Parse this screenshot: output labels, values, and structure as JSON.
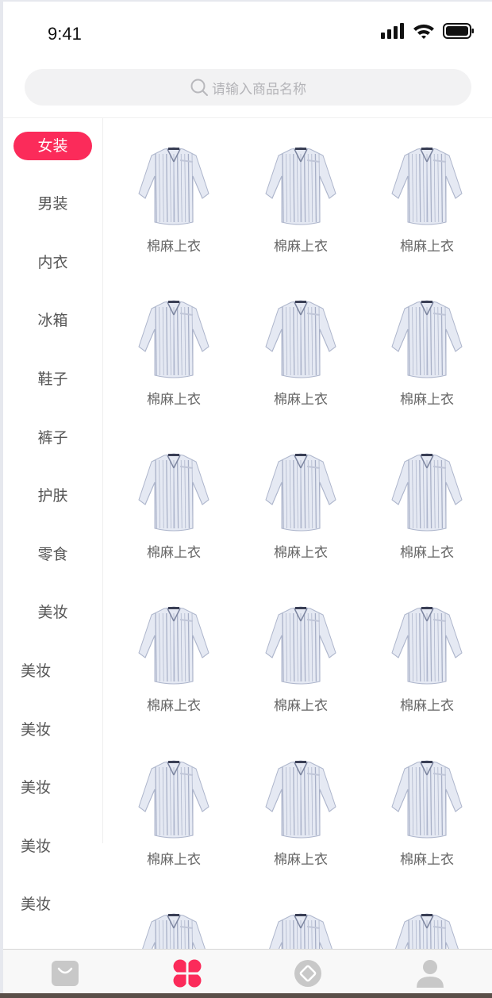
{
  "status": {
    "time": "9:41",
    "icons": [
      "signal-bars-icon",
      "wifi-icon",
      "battery-icon"
    ]
  },
  "search": {
    "placeholder": "请输入商品名称",
    "icon": "search-icon"
  },
  "categories": [
    {
      "label": "女装",
      "active": true
    },
    {
      "label": "男装"
    },
    {
      "label": "内衣"
    },
    {
      "label": "冰箱"
    },
    {
      "label": "鞋子"
    },
    {
      "label": "裤子"
    },
    {
      "label": "护肤"
    },
    {
      "label": "零食"
    },
    {
      "label": "美妆"
    },
    {
      "label": "美妆"
    },
    {
      "label": "美妆"
    },
    {
      "label": "美妆"
    },
    {
      "label": "美妆"
    },
    {
      "label": "美妆"
    }
  ],
  "products": [
    {
      "name": "棉麻上衣"
    },
    {
      "name": "棉麻上衣"
    },
    {
      "name": "棉麻上衣"
    },
    {
      "name": "棉麻上衣"
    },
    {
      "name": "棉麻上衣"
    },
    {
      "name": "棉麻上衣"
    },
    {
      "name": "棉麻上衣"
    },
    {
      "name": "棉麻上衣"
    },
    {
      "name": "棉麻上衣"
    },
    {
      "name": "棉麻上衣"
    },
    {
      "name": "棉麻上衣"
    },
    {
      "name": "棉麻上衣"
    },
    {
      "name": "棉麻上衣"
    },
    {
      "name": "棉麻上衣"
    },
    {
      "name": "棉麻上衣"
    },
    {
      "name": "",
      "image": "striped-shirt"
    },
    {
      "name": "",
      "image": "striped-shirt"
    },
    {
      "name": "",
      "image": "striped-shirt"
    }
  ],
  "tabbar": {
    "tabs": [
      {
        "icon": "shopping-bag-icon",
        "active": false
      },
      {
        "icon": "category-clover-icon",
        "active": true
      },
      {
        "icon": "discover-diamond-icon",
        "active": false
      },
      {
        "icon": "user-profile-icon",
        "active": false
      }
    ]
  },
  "colors": {
    "accent": "#fb2b5a",
    "inactive_icon": "#c8c8c8"
  }
}
